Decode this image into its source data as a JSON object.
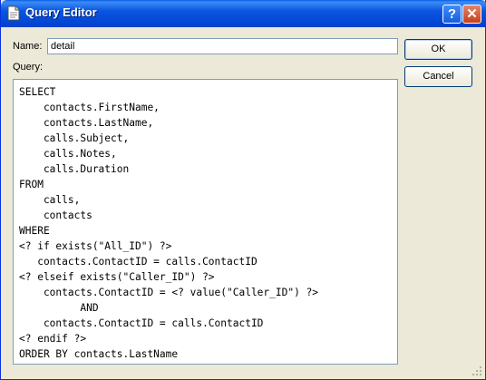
{
  "window": {
    "title": "Query Editor"
  },
  "titlebar": {
    "help_label": "?",
    "close_label": "✕"
  },
  "form": {
    "name_label": "Name:",
    "name_value": "detail",
    "query_label": "Query:",
    "query_text": "SELECT\n    contacts.FirstName,\n    contacts.LastName,\n    calls.Subject,\n    calls.Notes,\n    calls.Duration\nFROM\n    calls,\n    contacts\nWHERE\n<? if exists(\"All_ID\") ?>\n   contacts.ContactID = calls.ContactID\n<? elseif exists(\"Caller_ID\") ?>\n    contacts.ContactID = <? value(\"Caller_ID\") ?>\n          AND\n    contacts.ContactID = calls.ContactID\n<? endif ?>\nORDER BY contacts.LastName"
  },
  "buttons": {
    "ok_label": "OK",
    "cancel_label": "Cancel"
  },
  "icons": {
    "title": "document-icon",
    "resize": "resize-grip-icon"
  },
  "colors": {
    "titlebar": "#0046d5",
    "dialog_bg": "#ece9d8",
    "close_button": "#c7401b"
  }
}
